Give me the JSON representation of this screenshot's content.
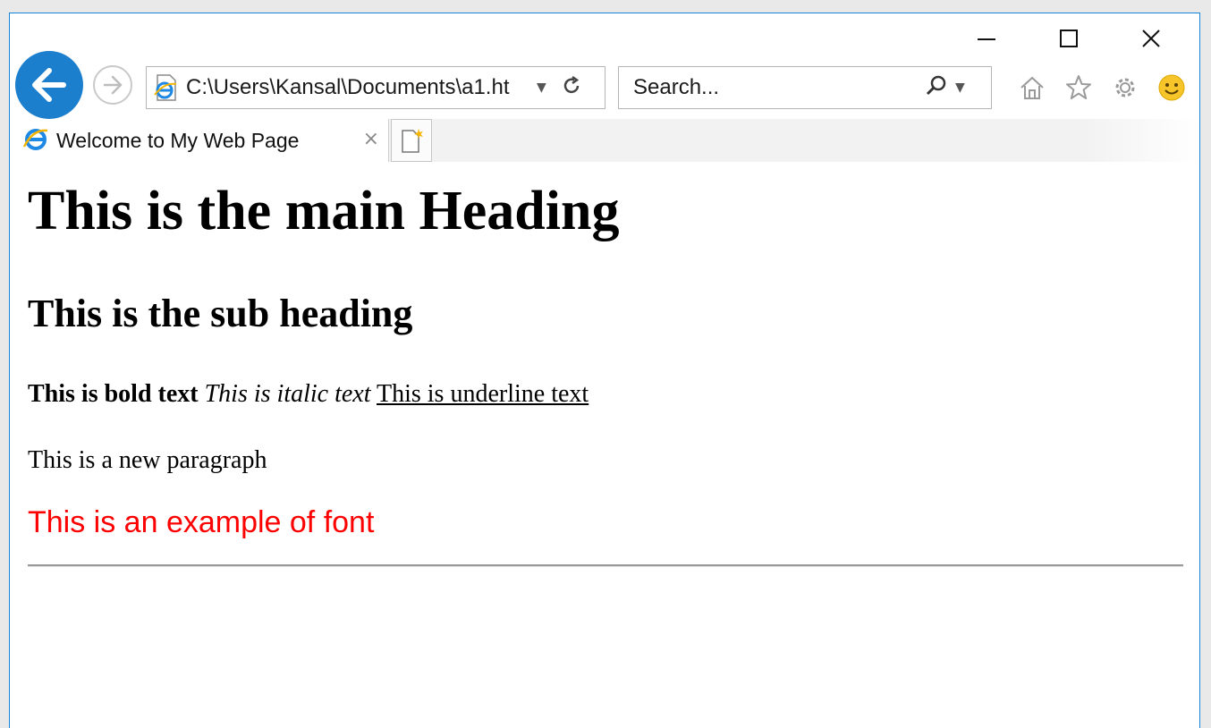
{
  "browser": {
    "address_url": "C:\\Users\\Kansal\\Documents\\a1.ht",
    "search_placeholder": "Search...",
    "tab": {
      "title": "Welcome to My Web Page",
      "close": "×"
    },
    "icons": {
      "back": "back-arrow-icon",
      "forward": "forward-arrow-icon",
      "page": "ie-page-icon",
      "dropdown": "chevron-down-icon",
      "refresh": "refresh-icon",
      "search": "search-icon",
      "home": "home-icon",
      "favorites": "star-icon",
      "tools": "gear-icon",
      "feedback": "smiley-icon",
      "new_tab": "new-tab-icon",
      "minimize": "minimize-icon",
      "maximize": "maximize-icon",
      "close": "close-icon"
    },
    "colors": {
      "accent": "#1b7fce",
      "border": "#1883d7"
    }
  },
  "page": {
    "heading": "This is the main Heading",
    "subheading": "This is the sub heading",
    "bold_text": "This is bold text",
    "italic_text": "This is italic text",
    "underline_text": "This is underline text",
    "paragraph": "This is a new paragraph",
    "font_example": "This is an example of font",
    "font_example_color": "#ff0000"
  }
}
